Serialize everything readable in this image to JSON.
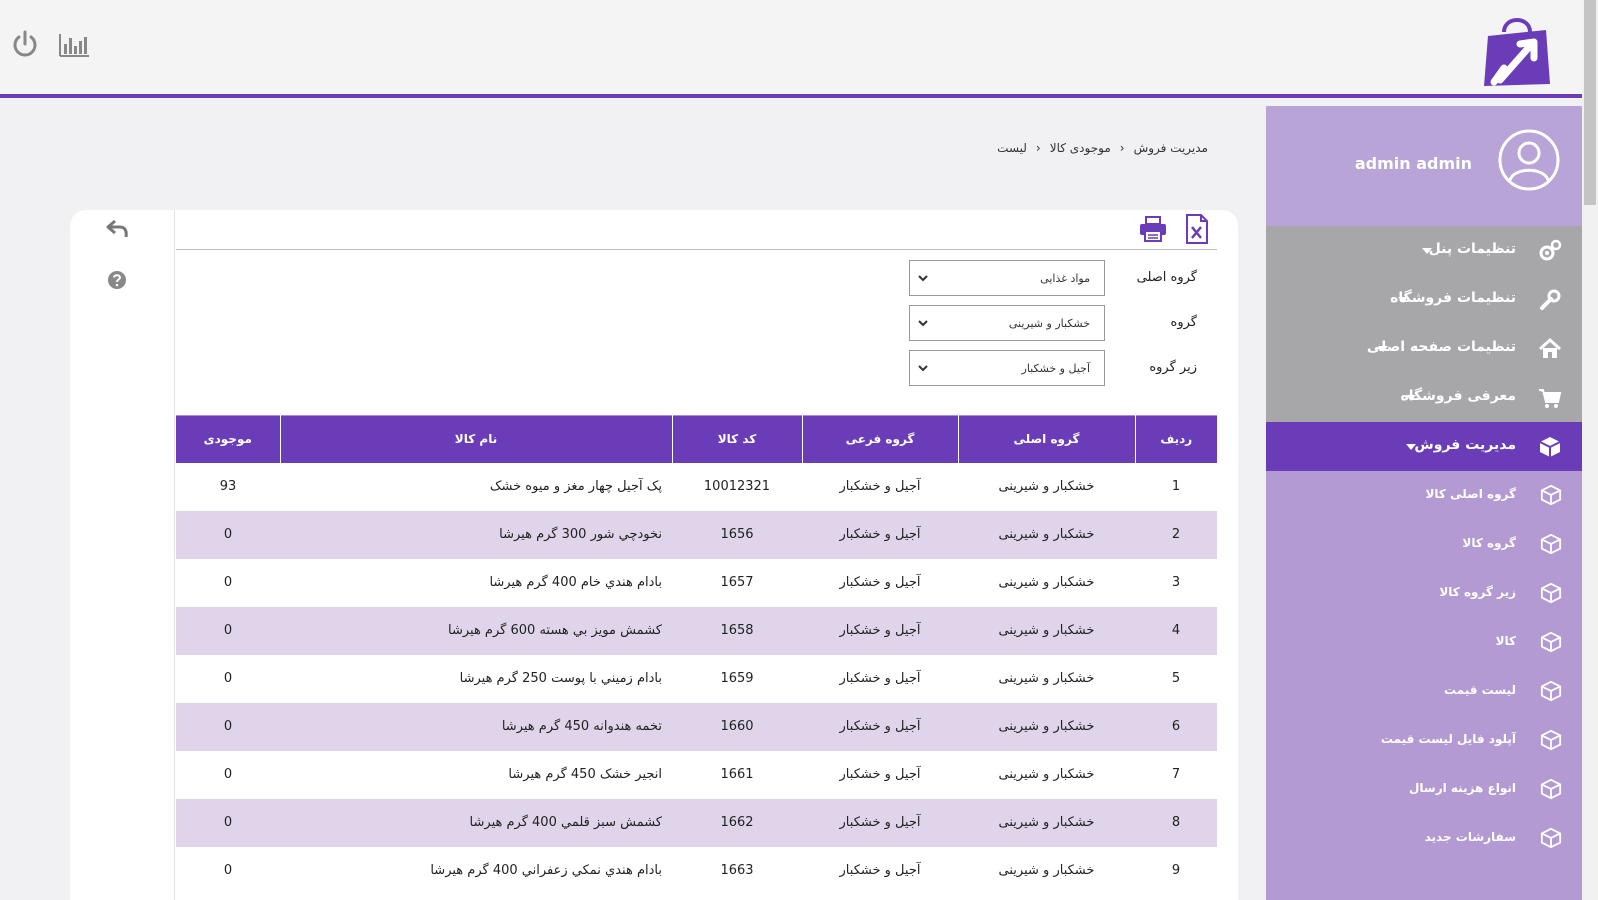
{
  "header": {
    "power_icon": "power-icon",
    "stats_icon": "bar-chart-icon",
    "brand_color": "#6a3cb8"
  },
  "sidebar": {
    "user_name": "admin admin",
    "menu": [
      {
        "label": "تنظیمات پنل",
        "icon": "gears-icon"
      },
      {
        "label": "تنظیمات فروشگاه",
        "icon": "wrench-icon"
      },
      {
        "label": "تنظیمات صفحه اصلی",
        "icon": "home-icon"
      },
      {
        "label": "معرفی فروشگاه",
        "icon": "cart-icon"
      },
      {
        "label": "مدیریت فروش",
        "icon": "cube-icon",
        "active": true
      }
    ],
    "submenu": [
      {
        "label": "گروه اصلی کالا"
      },
      {
        "label": "گروه کالا"
      },
      {
        "label": "زیر گروه کالا"
      },
      {
        "label": "کالا"
      },
      {
        "label": "لیست قیمت"
      },
      {
        "label": "آپلود فایل لیست قیمت"
      },
      {
        "label": "انواع هزینه ارسال"
      },
      {
        "label": "سفارشات جدید"
      }
    ]
  },
  "breadcrumb": {
    "items": [
      "مدیریت فروش",
      "موجودی کالا",
      "لیست"
    ]
  },
  "filters": {
    "main_group": {
      "label": "گروه اصلی",
      "value": "مواد غذایی"
    },
    "group": {
      "label": "گروه",
      "value": "خشکبار و شیرینی"
    },
    "sub_group": {
      "label": "زیر گروه",
      "value": "آجیل و خشکبار"
    }
  },
  "table": {
    "headers": [
      "ردیف",
      "گروه اصلی",
      "گروه فرعی",
      "کد کالا",
      "نام کالا",
      "موجودی"
    ],
    "rows": [
      [
        "1",
        "خشکبار و شیرینی",
        "آجیل و خشکبار",
        "10012321",
        "پک آجیل چهار مغز و میوه خشک",
        "93"
      ],
      [
        "2",
        "خشکبار و شیرینی",
        "آجیل و خشکبار",
        "1656",
        "نخودچي شور 300 گرم هيرشا",
        "0"
      ],
      [
        "3",
        "خشکبار و شیرینی",
        "آجیل و خشکبار",
        "1657",
        "بادام هندي خام 400 گرم هيرشا",
        "0"
      ],
      [
        "4",
        "خشکبار و شیرینی",
        "آجیل و خشکبار",
        "1658",
        "کشمش مويز بي هسته 600 گرم هيرشا",
        "0"
      ],
      [
        "5",
        "خشکبار و شیرینی",
        "آجیل و خشکبار",
        "1659",
        "بادام زميني با پوست 250 گرم هيرشا",
        "0"
      ],
      [
        "6",
        "خشکبار و شیرینی",
        "آجیل و خشکبار",
        "1660",
        "تخمه هندوانه 450 گرم هيرشا",
        "0"
      ],
      [
        "7",
        "خشکبار و شیرینی",
        "آجیل و خشکبار",
        "1661",
        "انجير خشک 450 گرم هيرشا",
        "0"
      ],
      [
        "8",
        "خشکبار و شیرینی",
        "آجیل و خشکبار",
        "1662",
        "کشمش سبز قلمي 400 گرم هيرشا",
        "0"
      ],
      [
        "9",
        "خشکبار و شیرینی",
        "آجیل و خشکبار",
        "1663",
        "بادام هندي نمکي زعفراني 400 گرم هيرشا",
        "0"
      ]
    ]
  }
}
